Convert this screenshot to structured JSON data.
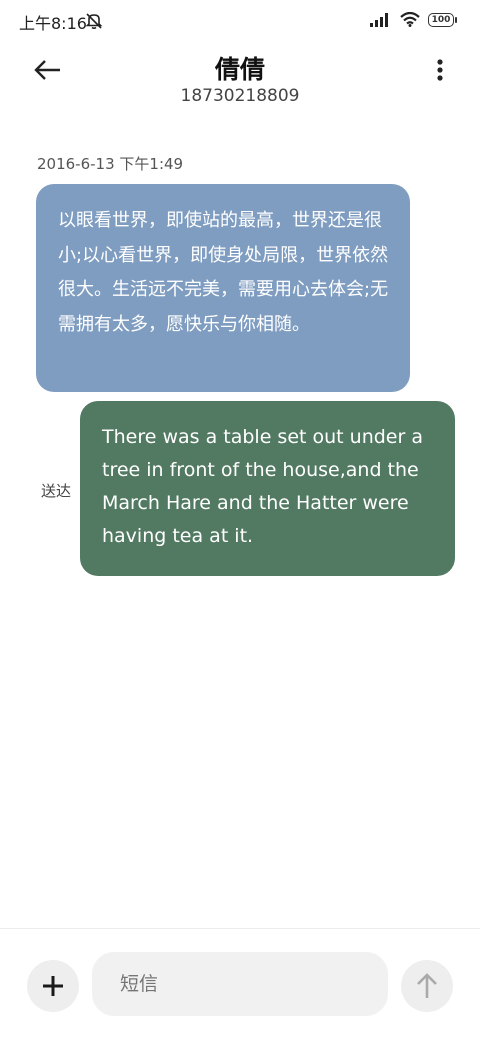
{
  "status_bar": {
    "time": "上午8:16",
    "battery": "100"
  },
  "header": {
    "contact_name": "倩倩",
    "phone_number": "18730218809"
  },
  "conversation": {
    "timestamp": "2016-6-13 下午1:49",
    "messages": [
      {
        "direction": "incoming",
        "text": "以眼看世界，即使站的最高，世界还是很小;以心看世界，即使身处局限，世界依然很大。生活远不完美，需要用心去体会;无需拥有太多，愿快乐与你相随。"
      },
      {
        "direction": "outgoing",
        "text": "There was a table set out under a tree in front of the house,and the March Hare and the Hatter were having tea at it.",
        "status": "送达"
      }
    ]
  },
  "composer": {
    "placeholder": "短信"
  },
  "colors": {
    "incoming_bubble": "#7f9dc0",
    "outgoing_bubble": "#527a62"
  }
}
